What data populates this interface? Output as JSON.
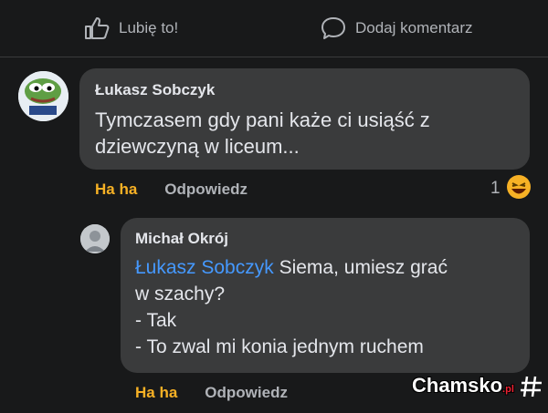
{
  "top_actions": {
    "like_label": "Lubię to!",
    "comment_label": "Dodaj komentarz"
  },
  "comments": [
    {
      "author": "Łukasz Sobczyk",
      "text": "Tymczasem gdy pani każe ci usiąść z\ndziewczyną w liceum...",
      "reaction_label": "Ha ha",
      "reply_label": "Odpowiedz",
      "reaction_count": "1"
    },
    {
      "author": "Michał Okrój",
      "mention": "Łukasz Sobczyk",
      "text": " Siema, umiesz grać\nw szachy?\n- Tak\n- To zwal mi konia jednym ruchem",
      "reaction_label": "Ha ha",
      "reply_label": "Odpowiedz"
    }
  ],
  "watermark": {
    "brand": "Chamsko",
    "suffix": ".pl"
  }
}
